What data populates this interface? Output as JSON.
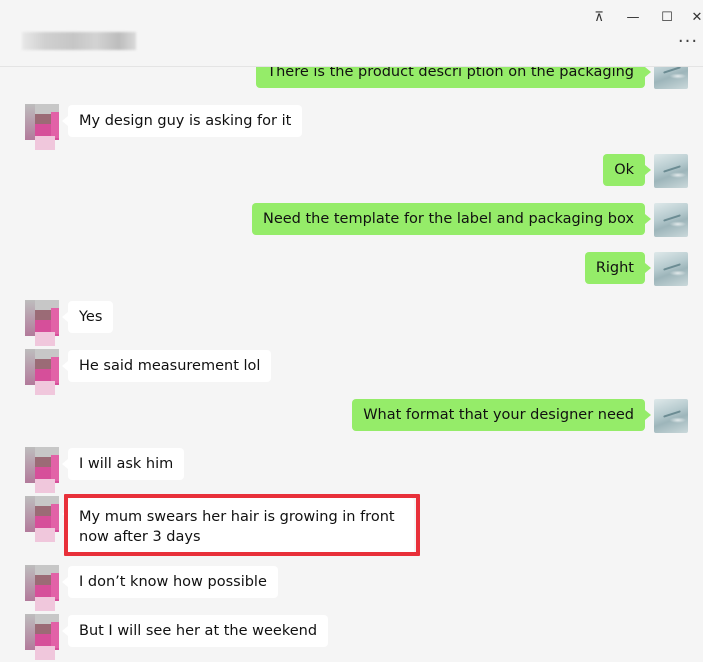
{
  "window": {
    "pin_icon": "pin-icon",
    "minimize_icon": "minimize-icon",
    "maximize_icon": "maximize-icon",
    "close_icon": "close-icon",
    "more_icon": "more-icon",
    "pin_glyph": "⊼",
    "minimize_glyph": "—",
    "maximize_glyph": "☐",
    "close_glyph": "✕",
    "more_glyph": "···"
  },
  "colors": {
    "outgoing_bubble": "#95ec69",
    "incoming_bubble": "#ffffff",
    "background": "#f5f5f5",
    "highlight_box": "#e8303a"
  },
  "messages": [
    {
      "direction": "out",
      "text": "There is the product descri ption on the packaging"
    },
    {
      "direction": "in",
      "text": "My design guy is asking for it"
    },
    {
      "direction": "out",
      "text": "Ok"
    },
    {
      "direction": "out",
      "text": "Need the template for the label and packaging box"
    },
    {
      "direction": "out",
      "text": "Right"
    },
    {
      "direction": "in",
      "text": "Yes"
    },
    {
      "direction": "in",
      "text": "He said measurement lol"
    },
    {
      "direction": "out",
      "text": "What format that your designer need"
    },
    {
      "direction": "in",
      "text": "I will ask him"
    },
    {
      "direction": "in",
      "text": "My mum swears her hair is growing in front now after 3 days",
      "highlighted": true
    },
    {
      "direction": "in",
      "text": "I don’t know how possible"
    },
    {
      "direction": "in",
      "text": "But I will see her at the weekend"
    }
  ]
}
